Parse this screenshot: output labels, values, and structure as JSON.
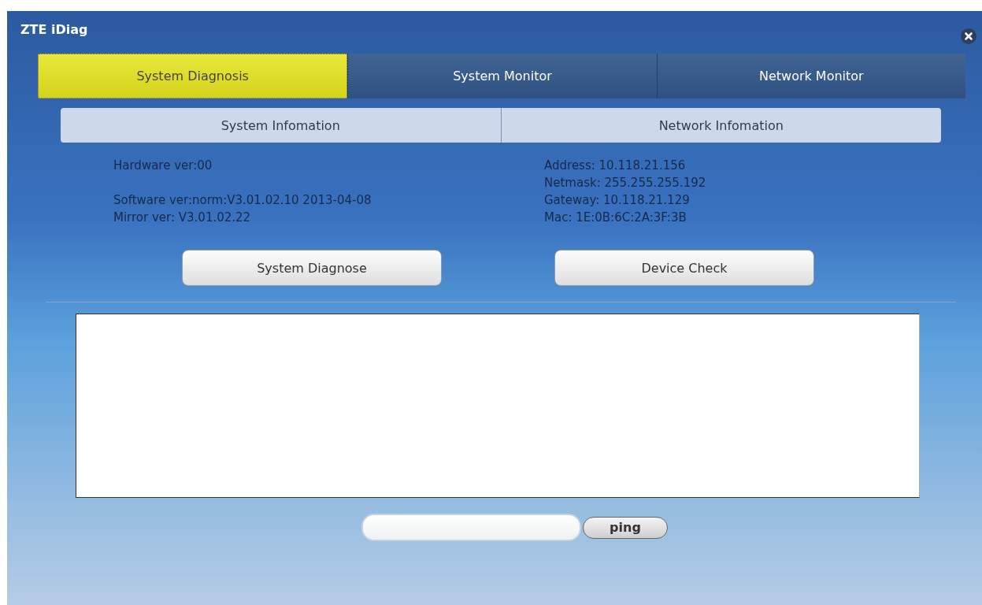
{
  "window": {
    "title": "ZTE iDiag"
  },
  "tabs": [
    {
      "label": "System Diagnosis",
      "selected": true
    },
    {
      "label": "System Monitor",
      "selected": false
    },
    {
      "label": "Network Monitor",
      "selected": false
    }
  ],
  "subtabs": [
    "System Infomation",
    "Network Infomation"
  ],
  "system_info": [
    [
      "Hardware ver:00"
    ],
    [
      "Software ver:norm:V3.01.02.10 2013-04-08",
      "Mirror ver: V3.01.02.22"
    ]
  ],
  "network_info": [
    "Address: 10.118.21.156",
    "Netmask: 255.255.255.192",
    "Gateway: 10.118.21.129",
    "Mac: 1E:0B:6C:2A:3F:3B"
  ],
  "buttons": [
    "System Diagnose",
    "Device Check"
  ],
  "ping": {
    "button": "ping"
  }
}
